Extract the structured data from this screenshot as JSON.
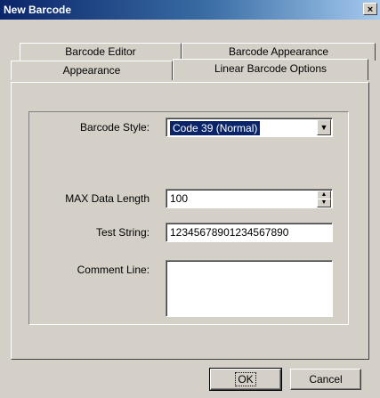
{
  "window": {
    "title": "New Barcode",
    "close_glyph": "×"
  },
  "tabs": {
    "row_back": [
      "Barcode Editor",
      "Barcode Appearance"
    ],
    "row_front": [
      "Appearance",
      "Linear Barcode Options"
    ],
    "active": "Linear Barcode Options"
  },
  "form": {
    "barcode_style": {
      "label": "Barcode Style:",
      "value": "Code 39 (Normal)",
      "arrow": "▼"
    },
    "max_data_length": {
      "label": "MAX Data Length",
      "value": "100",
      "up": "▲",
      "down": "▼"
    },
    "test_string": {
      "label": "Test String:",
      "value": "12345678901234567890"
    },
    "comment_line": {
      "label": "Comment Line:",
      "value": ""
    }
  },
  "buttons": {
    "ok": "OK",
    "cancel": "Cancel"
  }
}
